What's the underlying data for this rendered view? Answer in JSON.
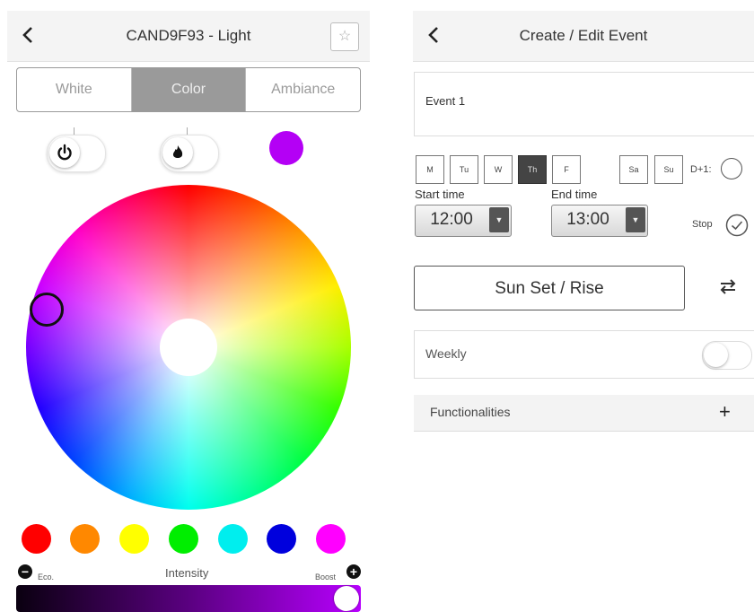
{
  "left": {
    "title": "CAND9F93 - Light",
    "star": "☆",
    "tabs": [
      {
        "label": "White",
        "active": false
      },
      {
        "label": "Color",
        "active": true
      },
      {
        "label": "Ambiance",
        "active": false
      }
    ],
    "selected_color": "#b400f5",
    "presets": [
      "#ff0000",
      "#ff8800",
      "#ffff00",
      "#00ee00",
      "#00eeee",
      "#0000dd",
      "#ff00ff"
    ],
    "intensity": {
      "label": "Intensity",
      "eco_label": "Eco.",
      "boost_label": "Boost",
      "minus": "−",
      "plus": "+",
      "level": 1.0
    }
  },
  "right": {
    "title": "Create / Edit Event",
    "event_name": "Event 1",
    "days": [
      {
        "label": "M",
        "active": false
      },
      {
        "label": "Tu",
        "active": false
      },
      {
        "label": "W",
        "active": false
      },
      {
        "label": "Th",
        "active": true
      },
      {
        "label": "F",
        "active": false
      },
      {
        "label": "Sa",
        "active": false
      },
      {
        "label": "Su",
        "active": false
      }
    ],
    "d1_label": "D+1:",
    "start_label": "Start time",
    "start_value": "12:00",
    "end_label": "End time",
    "end_value": "13:00",
    "dropdown_arrow": "▼",
    "stop_label": "Stop",
    "sun_button": "Sun Set / Rise",
    "weekly_label": "Weekly",
    "weekly_on": false,
    "functionalities_label": "Functionalities",
    "functionalities_plus": "+"
  }
}
